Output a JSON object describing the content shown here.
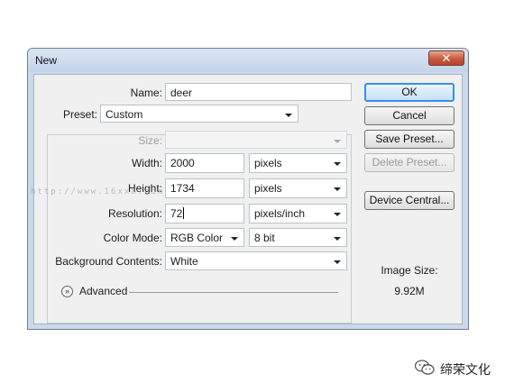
{
  "window": {
    "title": "New",
    "close_icon": "close-icon"
  },
  "form": {
    "name": {
      "label": "Name:",
      "value": "deer"
    },
    "preset": {
      "label": "Preset:",
      "value": "Custom"
    },
    "size": {
      "label": "Size:",
      "value": ""
    },
    "width": {
      "label": "Width:",
      "value": "2000",
      "unit": "pixels"
    },
    "height": {
      "label": "Height:",
      "value": "1734",
      "unit": "pixels"
    },
    "resolution": {
      "label": "Resolution:",
      "value": "72",
      "unit": "pixels/inch"
    },
    "color_mode": {
      "label": "Color Mode:",
      "mode": "RGB Color",
      "depth": "8 bit"
    },
    "background": {
      "label": "Background Contents:",
      "value": "White"
    },
    "advanced": {
      "label": "Advanced"
    }
  },
  "buttons": {
    "ok": "OK",
    "cancel": "Cancel",
    "save_preset": "Save Preset...",
    "delete_preset": "Delete Preset...",
    "device_central": "Device Central..."
  },
  "image_size": {
    "label": "Image Size:",
    "value": "9.92M"
  },
  "watermark_text": "http://www.16xx8.com",
  "brand": {
    "text": "缔荣文化"
  }
}
